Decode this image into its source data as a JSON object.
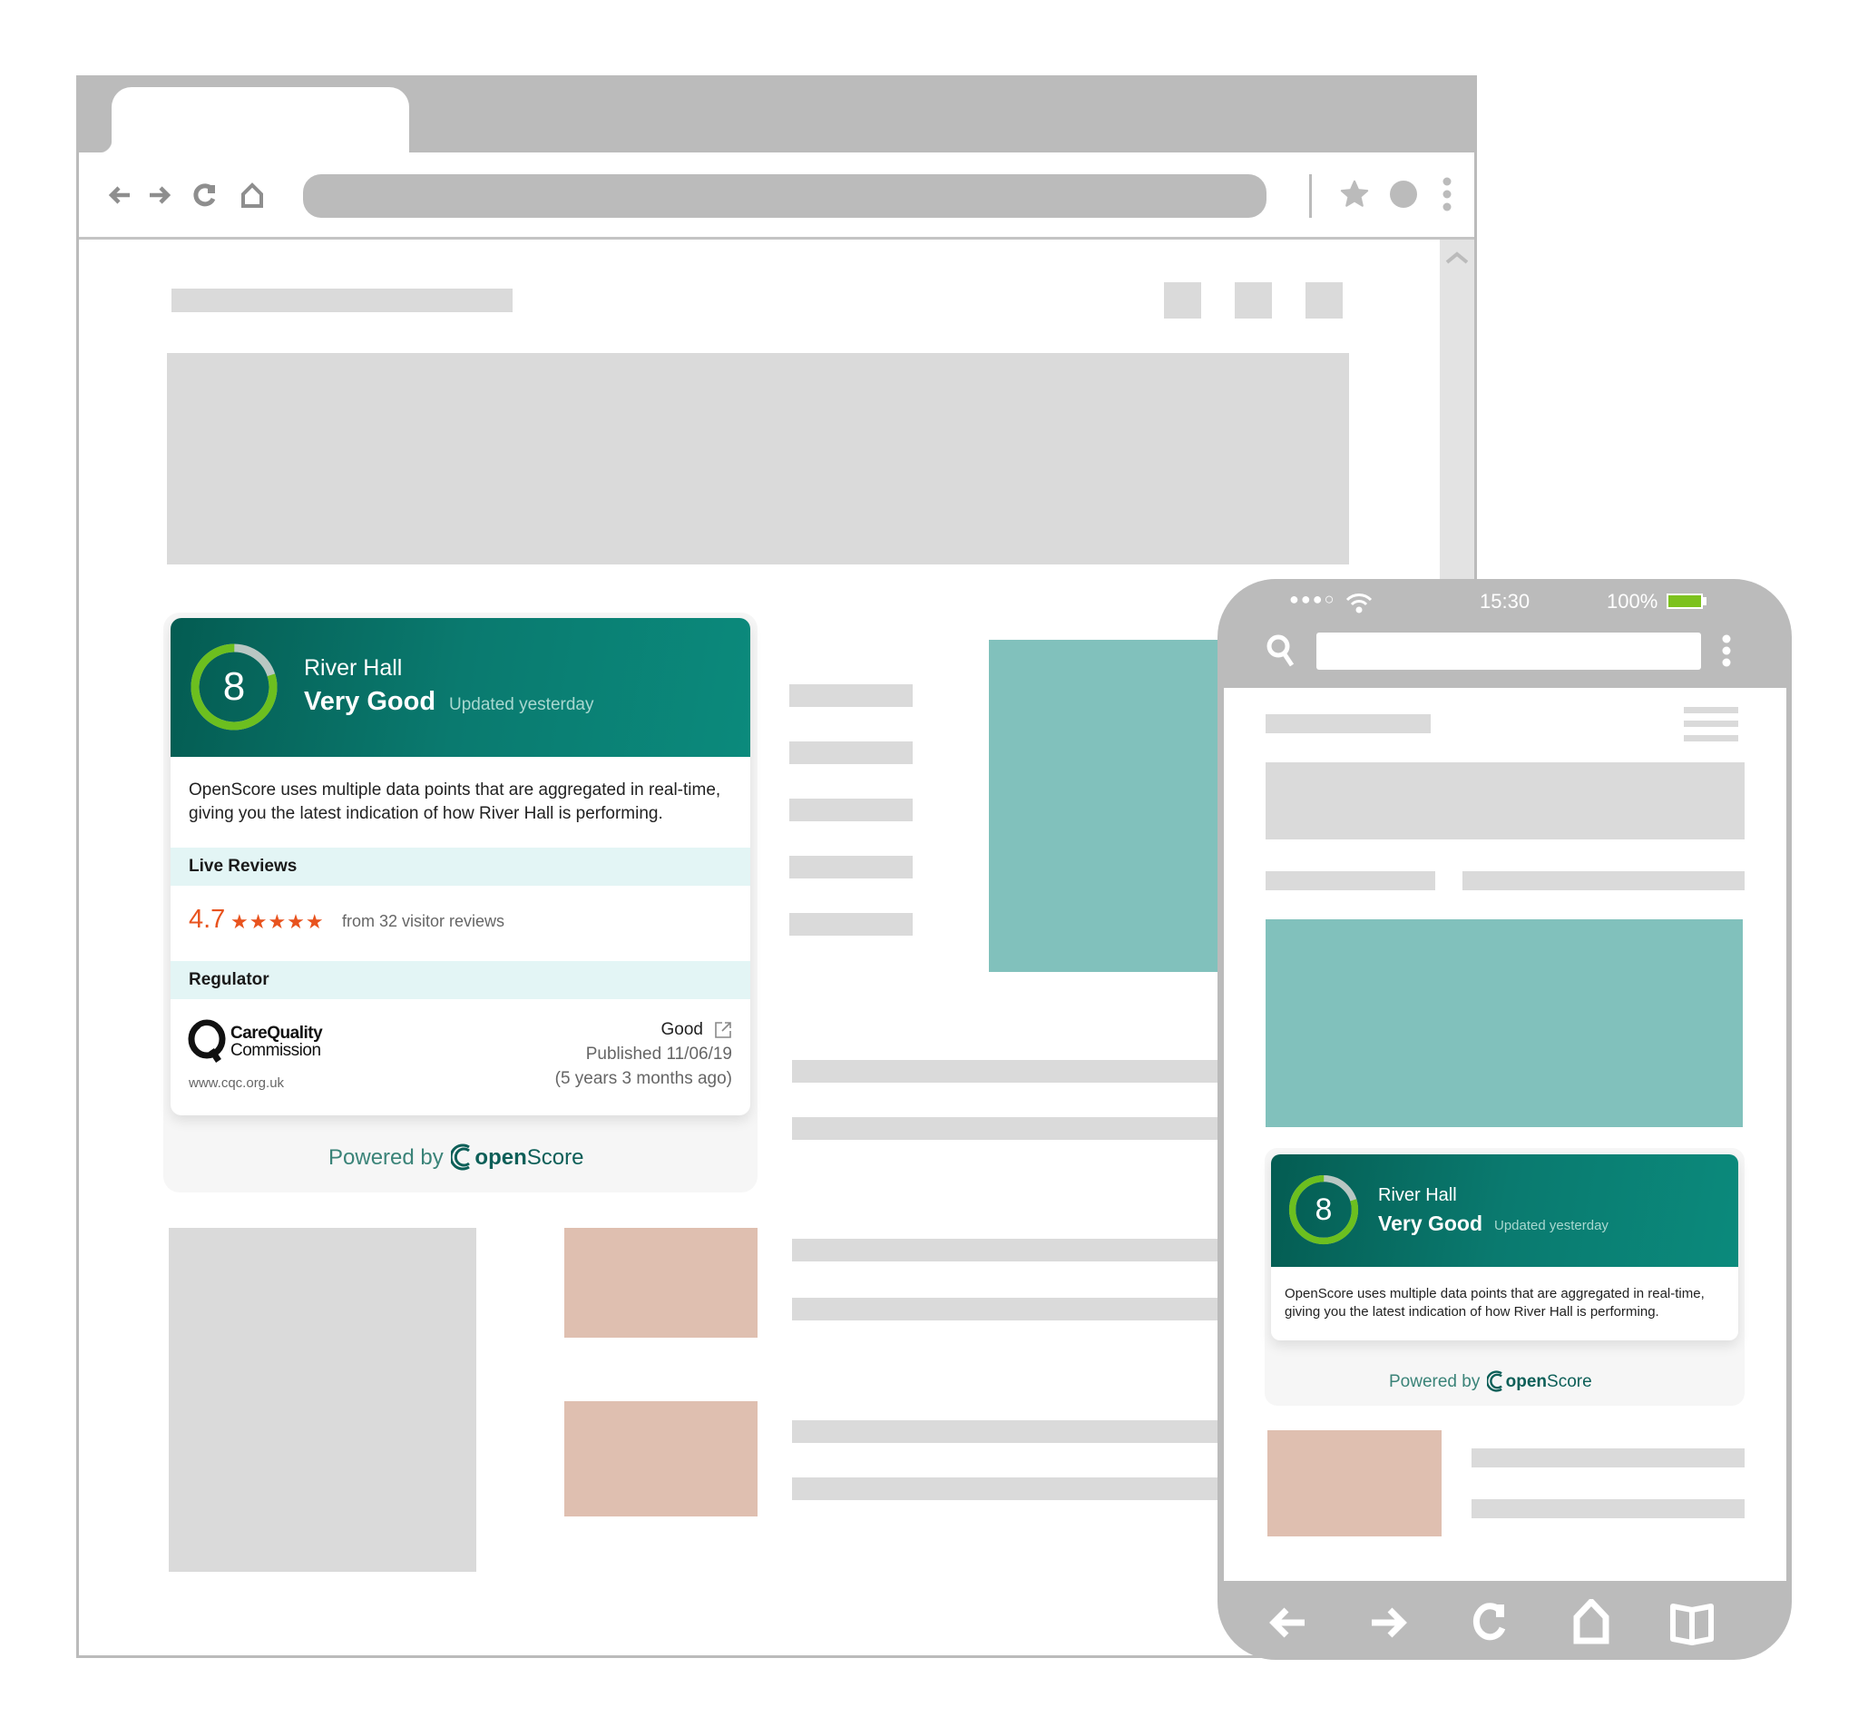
{
  "browser": {
    "toolbar_icons": [
      "back-arrow-icon",
      "forward-arrow-icon",
      "reload-icon",
      "home-icon",
      "star-icon",
      "profile-icon",
      "menu-dots-icon"
    ],
    "scroll_up_icon": "chevron-up-icon"
  },
  "widget": {
    "score": "8",
    "score_fraction": 0.8,
    "place_name": "River Hall",
    "rating_label": "Very Good",
    "updated": "Updated yesterday",
    "description": "OpenScore uses multiple data points that are aggregated in real-time, giving you the latest indication of how River Hall is performing.",
    "live_reviews": {
      "heading": "Live Reviews",
      "average": "4.7",
      "stars": 4.7,
      "stars_max": 5,
      "stars_glyph": "★★★★★",
      "count_text": "from 32 visitor reviews"
    },
    "regulator": {
      "heading": "Regulator",
      "logo_line1": "CareQuality",
      "logo_line2": "Commission",
      "url": "www.cqc.org.uk",
      "rating": "Good",
      "published": "Published 11/06/19",
      "age": "(5 years 3 months ago)"
    },
    "powered_by": "Powered by",
    "brand_prefix": "open",
    "brand_suffix": "Score",
    "colors": {
      "header_dark": "#045c52",
      "header_light": "#0b8a7c",
      "ring_green": "#6cbf1f",
      "review_orange": "#e8531e",
      "section_bg": "#e3f5f5"
    }
  },
  "phone": {
    "signal": "●●●○",
    "time": "15:30",
    "battery": "100%",
    "battery_fraction": 1.0,
    "nav_icons": [
      "back-arrow-icon",
      "forward-arrow-icon",
      "reload-icon",
      "home-icon",
      "book-icon"
    ]
  }
}
